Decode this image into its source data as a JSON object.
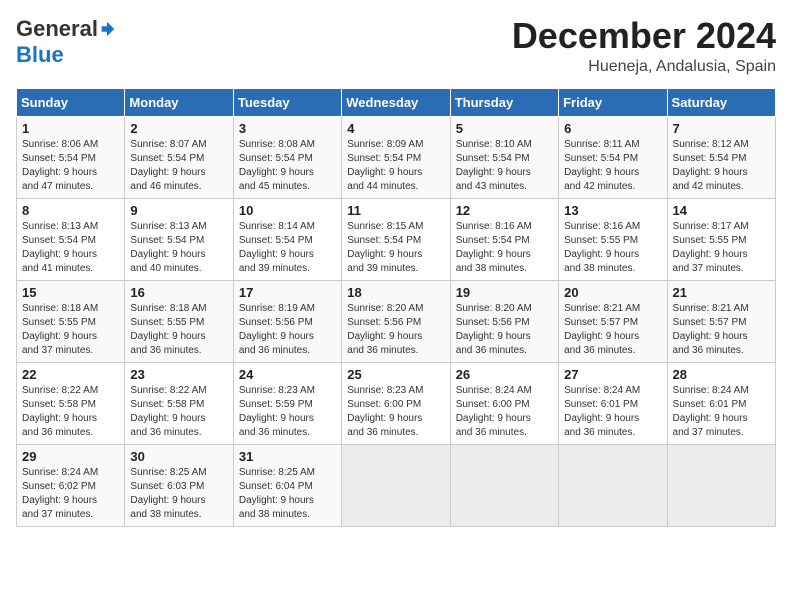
{
  "header": {
    "logo_general": "General",
    "logo_blue": "Blue",
    "title": "December 2024",
    "subtitle": "Hueneja, Andalusia, Spain"
  },
  "days_of_week": [
    "Sunday",
    "Monday",
    "Tuesday",
    "Wednesday",
    "Thursday",
    "Friday",
    "Saturday"
  ],
  "weeks": [
    [
      {
        "day": "1",
        "sunrise": "8:06 AM",
        "sunset": "5:54 PM",
        "daylight": "9 hours and 47 minutes."
      },
      {
        "day": "2",
        "sunrise": "8:07 AM",
        "sunset": "5:54 PM",
        "daylight": "9 hours and 46 minutes."
      },
      {
        "day": "3",
        "sunrise": "8:08 AM",
        "sunset": "5:54 PM",
        "daylight": "9 hours and 45 minutes."
      },
      {
        "day": "4",
        "sunrise": "8:09 AM",
        "sunset": "5:54 PM",
        "daylight": "9 hours and 44 minutes."
      },
      {
        "day": "5",
        "sunrise": "8:10 AM",
        "sunset": "5:54 PM",
        "daylight": "9 hours and 43 minutes."
      },
      {
        "day": "6",
        "sunrise": "8:11 AM",
        "sunset": "5:54 PM",
        "daylight": "9 hours and 42 minutes."
      },
      {
        "day": "7",
        "sunrise": "8:12 AM",
        "sunset": "5:54 PM",
        "daylight": "9 hours and 42 minutes."
      }
    ],
    [
      {
        "day": "8",
        "sunrise": "8:13 AM",
        "sunset": "5:54 PM",
        "daylight": "9 hours and 41 minutes."
      },
      {
        "day": "9",
        "sunrise": "8:13 AM",
        "sunset": "5:54 PM",
        "daylight": "9 hours and 40 minutes."
      },
      {
        "day": "10",
        "sunrise": "8:14 AM",
        "sunset": "5:54 PM",
        "daylight": "9 hours and 39 minutes."
      },
      {
        "day": "11",
        "sunrise": "8:15 AM",
        "sunset": "5:54 PM",
        "daylight": "9 hours and 39 minutes."
      },
      {
        "day": "12",
        "sunrise": "8:16 AM",
        "sunset": "5:54 PM",
        "daylight": "9 hours and 38 minutes."
      },
      {
        "day": "13",
        "sunrise": "8:16 AM",
        "sunset": "5:55 PM",
        "daylight": "9 hours and 38 minutes."
      },
      {
        "day": "14",
        "sunrise": "8:17 AM",
        "sunset": "5:55 PM",
        "daylight": "9 hours and 37 minutes."
      }
    ],
    [
      {
        "day": "15",
        "sunrise": "8:18 AM",
        "sunset": "5:55 PM",
        "daylight": "9 hours and 37 minutes."
      },
      {
        "day": "16",
        "sunrise": "8:18 AM",
        "sunset": "5:55 PM",
        "daylight": "9 hours and 36 minutes."
      },
      {
        "day": "17",
        "sunrise": "8:19 AM",
        "sunset": "5:56 PM",
        "daylight": "9 hours and 36 minutes."
      },
      {
        "day": "18",
        "sunrise": "8:20 AM",
        "sunset": "5:56 PM",
        "daylight": "9 hours and 36 minutes."
      },
      {
        "day": "19",
        "sunrise": "8:20 AM",
        "sunset": "5:56 PM",
        "daylight": "9 hours and 36 minutes."
      },
      {
        "day": "20",
        "sunrise": "8:21 AM",
        "sunset": "5:57 PM",
        "daylight": "9 hours and 36 minutes."
      },
      {
        "day": "21",
        "sunrise": "8:21 AM",
        "sunset": "5:57 PM",
        "daylight": "9 hours and 36 minutes."
      }
    ],
    [
      {
        "day": "22",
        "sunrise": "8:22 AM",
        "sunset": "5:58 PM",
        "daylight": "9 hours and 36 minutes."
      },
      {
        "day": "23",
        "sunrise": "8:22 AM",
        "sunset": "5:58 PM",
        "daylight": "9 hours and 36 minutes."
      },
      {
        "day": "24",
        "sunrise": "8:23 AM",
        "sunset": "5:59 PM",
        "daylight": "9 hours and 36 minutes."
      },
      {
        "day": "25",
        "sunrise": "8:23 AM",
        "sunset": "6:00 PM",
        "daylight": "9 hours and 36 minutes."
      },
      {
        "day": "26",
        "sunrise": "8:24 AM",
        "sunset": "6:00 PM",
        "daylight": "9 hours and 36 minutes."
      },
      {
        "day": "27",
        "sunrise": "8:24 AM",
        "sunset": "6:01 PM",
        "daylight": "9 hours and 36 minutes."
      },
      {
        "day": "28",
        "sunrise": "8:24 AM",
        "sunset": "6:01 PM",
        "daylight": "9 hours and 37 minutes."
      }
    ],
    [
      {
        "day": "29",
        "sunrise": "8:24 AM",
        "sunset": "6:02 PM",
        "daylight": "9 hours and 37 minutes."
      },
      {
        "day": "30",
        "sunrise": "8:25 AM",
        "sunset": "6:03 PM",
        "daylight": "9 hours and 38 minutes."
      },
      {
        "day": "31",
        "sunrise": "8:25 AM",
        "sunset": "6:04 PM",
        "daylight": "9 hours and 38 minutes."
      },
      null,
      null,
      null,
      null
    ]
  ]
}
